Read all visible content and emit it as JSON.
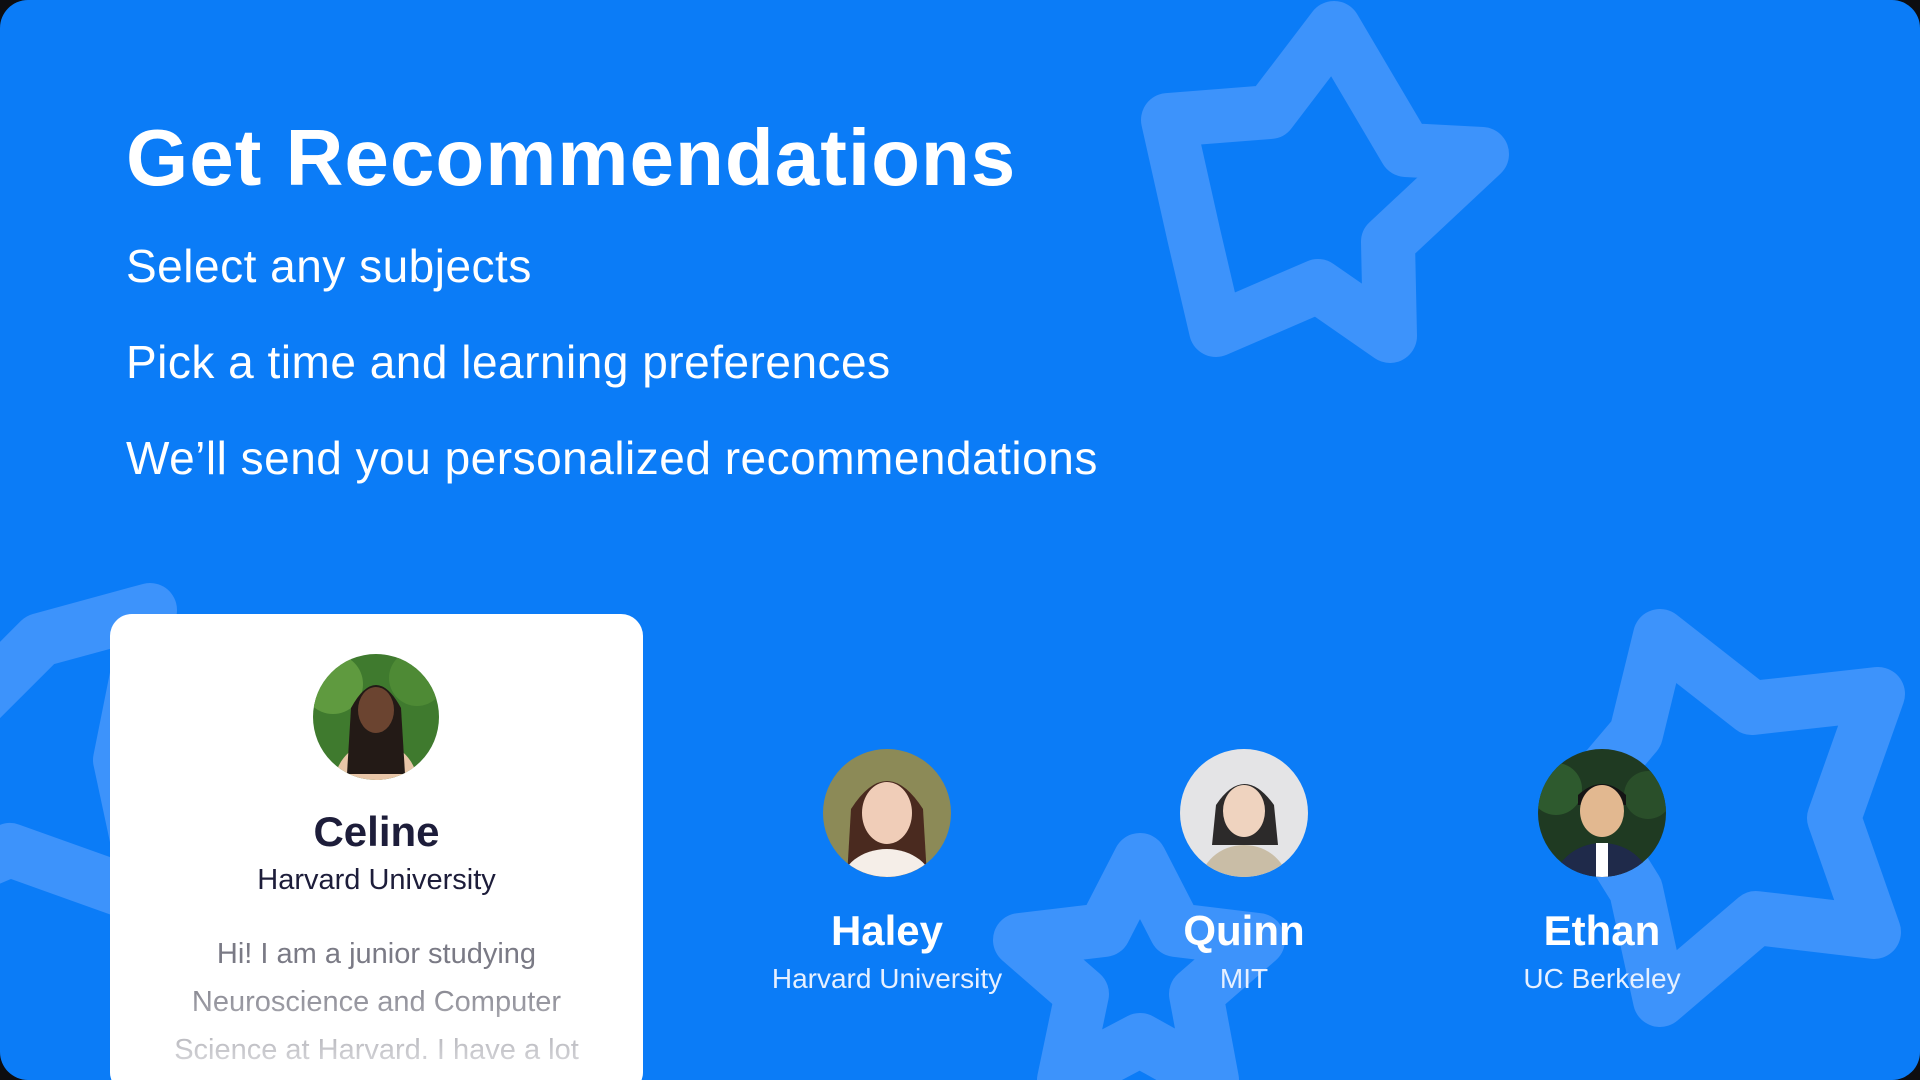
{
  "theme": {
    "background": "#0b7cf7",
    "star": "#3d93fb",
    "card": "#ffffff",
    "ink": "#1d1d3a",
    "muted": "#7a7a85"
  },
  "slide": {
    "title": "Get Recommendations",
    "steps": [
      "Select any subjects",
      "Pick a time and learning preferences",
      "We’ll send you personalized recommendations"
    ]
  },
  "decorations": {
    "icons": [
      "star-outline-icon",
      "star-outline-icon",
      "star-outline-icon",
      "star-outline-icon"
    ]
  },
  "featured_tutor": {
    "name": "Celine",
    "school": "Harvard University",
    "bio": "Hi! I am a junior studying Neuroscience and Computer Science at Harvard. I have a lot"
  },
  "tutors": [
    {
      "name": "Haley",
      "school": "Harvard University"
    },
    {
      "name": "Quinn",
      "school": "MIT"
    },
    {
      "name": "Ethan",
      "school": "UC Berkeley"
    }
  ]
}
